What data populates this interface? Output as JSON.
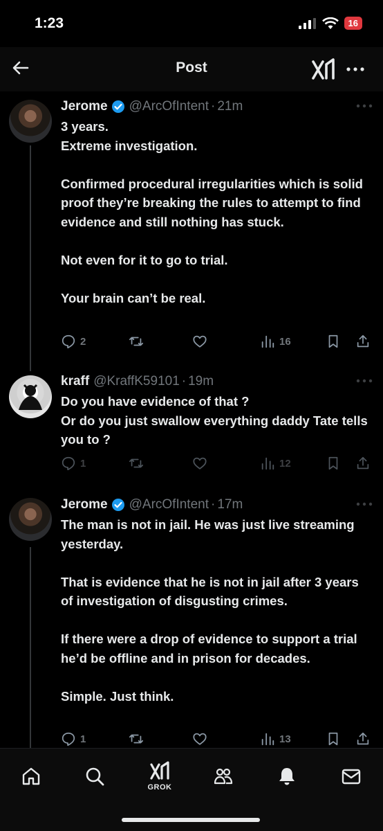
{
  "status_bar": {
    "time": "1:23",
    "battery": "16"
  },
  "header": {
    "title": "Post"
  },
  "posts": [
    {
      "name": "Jerome",
      "handle": "@ArcOfIntent",
      "time": "21m",
      "body": [
        "3 years.",
        "Extreme investigation.",
        "",
        "Confirmed procedural irregularities which is solid proof they’re breaking the rules to attempt to find evidence and still nothing has stuck.",
        "",
        "Not even for it to go to trial.",
        "",
        "Your brain can’t be real."
      ],
      "replies": "2",
      "reposts": "",
      "likes": "",
      "views": "16"
    },
    {
      "name": "kraff",
      "handle": "@KraffK59101",
      "time": "19m",
      "body": [
        "Do you have evidence of that ?",
        "Or do you just swallow everything daddy Tate tells you to ?"
      ],
      "replies": "1",
      "reposts": "",
      "likes": "",
      "views": "12"
    },
    {
      "name": "Jerome",
      "handle": "@ArcOfIntent",
      "time": "17m",
      "body": [
        "The man is not in jail. He was just live streaming yesterday.",
        "",
        "That is evidence that he is not in jail after 3 years of investigation of disgusting crimes.",
        "",
        "If there were a drop of evidence to support a trial he’d be offline and in prison for decades.",
        "",
        "Simple. Just think."
      ],
      "replies": "1",
      "reposts": "",
      "likes": "",
      "views": "13"
    }
  ],
  "nav": {
    "items": [
      "home-icon",
      "search-icon",
      "grok-icon",
      "communities-icon",
      "notifications-icon",
      "messages-icon"
    ],
    "grok_label": "GROK"
  },
  "colors": {
    "background": "#000000",
    "text": "#e7e9ea",
    "muted": "#71767b",
    "verified": "#1d9bf0",
    "battery": "#e0383e"
  }
}
